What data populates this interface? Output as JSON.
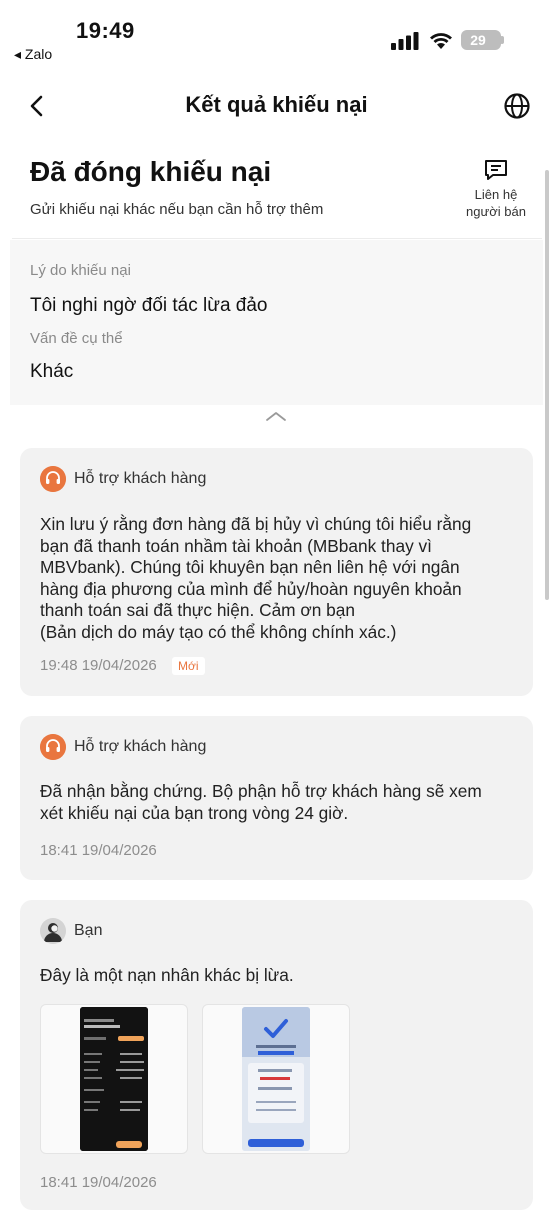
{
  "status_bar": {
    "time": "19:49",
    "back_app": "◂ Zalo",
    "battery": "29"
  },
  "nav": {
    "title": "Kết quả khiếu nại"
  },
  "header": {
    "title": "Đã đóng khiếu nại",
    "subtitle": "Gửi khiếu nại khác nếu bạn cần hỗ trợ thêm",
    "contact_line1": "Liên hệ",
    "contact_line2": "người bán"
  },
  "reason": {
    "reason_label": "Lý do khiếu nại",
    "reason_value": "Tôi nghi ngờ đối tác lừa đảo",
    "issue_label": "Vấn đề cụ thể",
    "issue_value": "Khác"
  },
  "messages": [
    {
      "sender": "Hỗ trợ khách hàng",
      "lines": [
        "Xin lưu ý rằng đơn hàng đã bị hủy vì chúng tôi hiểu rằng",
        "bạn đã thanh toán nhầm tài khoản (MBbank thay vì",
        "MBVbank). Chúng tôi khuyên bạn nên liên hệ với ngân",
        "hàng địa phương của mình để hủy/hoàn nguyên khoản",
        "thanh toán sai đã thực hiện. Cảm ơn bạn",
        "(Bản dịch do máy tạo có thể không chính xác.)"
      ],
      "time": "19:48 19/04/2026",
      "badge": "Mới"
    },
    {
      "sender": "Hỗ trợ khách hàng",
      "lines": [
        "Đã nhận bằng chứng. Bộ phận hỗ trợ khách hàng sẽ xem",
        "xét khiếu nại của bạn trong vòng 24 giờ."
      ],
      "time": "18:41 19/04/2026"
    },
    {
      "sender": "Bạn",
      "lines": [
        "Đây là một nạn nhân khác bị lừa."
      ],
      "time": "18:41 19/04/2026"
    }
  ],
  "colors": {
    "accent": "#e9763f",
    "card_bg": "#f2f2f2",
    "muted_text": "#8d8d8d"
  }
}
